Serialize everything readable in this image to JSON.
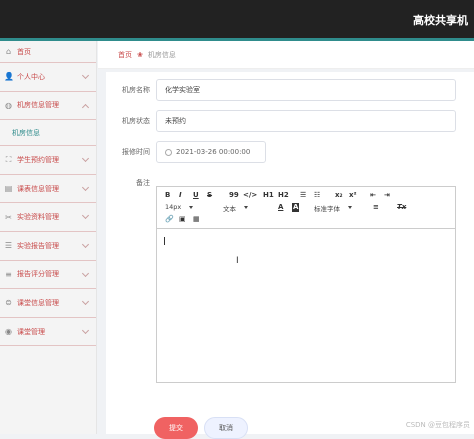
{
  "header": {
    "title": "高校共享机"
  },
  "sidebar": {
    "home": "首页",
    "items": [
      {
        "label": "个人中心"
      },
      {
        "label": "机房信息管理",
        "expanded": true,
        "children": [
          {
            "label": "机房信息"
          }
        ]
      },
      {
        "label": "学生预约管理"
      },
      {
        "label": "课表信息管理"
      },
      {
        "label": "实验资料管理"
      },
      {
        "label": "实验报告管理"
      },
      {
        "label": "报告评分管理"
      },
      {
        "label": "课堂信息管理"
      },
      {
        "label": "课堂管理"
      }
    ]
  },
  "breadcrumb": {
    "home": "首页",
    "current": "机房信息"
  },
  "form": {
    "room_name_label": "机房名称",
    "room_name_value": "化学实验室",
    "room_status_label": "机房状态",
    "room_status_value": "未预约",
    "report_time_label": "报修时间",
    "report_time_value": "2021-03-26 00:00:00",
    "remarks_label": "备注"
  },
  "editor": {
    "toolbar": {
      "bold": "B",
      "italic": "I",
      "underline": "U",
      "strike": "S",
      "quote": "99",
      "code": "</>",
      "h1": "H1",
      "h2": "H2",
      "sub": "x₂",
      "sup": "x²",
      "size": "14px",
      "header": "文本",
      "font": "标准字体",
      "clean": "Tx"
    }
  },
  "buttons": {
    "submit": "提交",
    "cancel": "取消"
  },
  "watermark": "CSDN @豆包程序员",
  "colors": {
    "accent": "#2f8c8c",
    "danger": "#f06262",
    "menu_text": "#c84a4a"
  }
}
